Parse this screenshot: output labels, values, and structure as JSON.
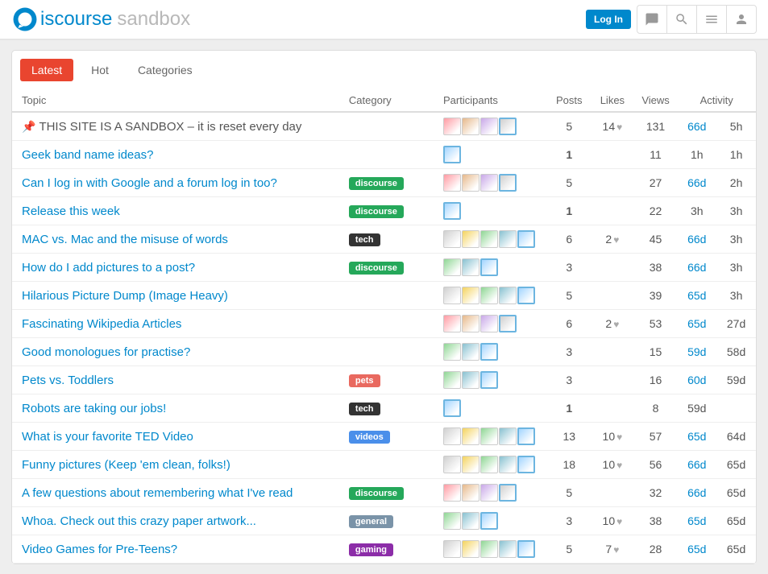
{
  "header": {
    "logo_main": "iscourse",
    "logo_sub": "sandbox",
    "login": "Log In"
  },
  "tabs": {
    "latest": "Latest",
    "hot": "Hot",
    "categories": "Categories"
  },
  "columns": {
    "topic": "Topic",
    "category": "Category",
    "participants": "Participants",
    "posts": "Posts",
    "likes": "Likes",
    "views": "Views",
    "activity": "Activity"
  },
  "topics": [
    {
      "title": "THIS SITE IS A SANDBOX – it is reset every day",
      "pinned": true,
      "dark": true,
      "category": "",
      "catclass": "",
      "avatars": 4,
      "posts": "5",
      "likes": "14",
      "views": "131",
      "act1": "66d",
      "act2": "5h"
    },
    {
      "title": "Geek band name ideas?",
      "pinned": false,
      "dark": false,
      "category": "",
      "catclass": "",
      "avatars": 1,
      "posts": "1",
      "likes": "",
      "views": "11",
      "act1": "1h",
      "act1link": false,
      "act2": "1h"
    },
    {
      "title": "Can I log in with Google and a forum log in too?",
      "pinned": false,
      "dark": false,
      "category": "discourse",
      "catclass": "cat-discourse",
      "avatars": 4,
      "posts": "5",
      "likes": "",
      "views": "27",
      "act1": "66d",
      "act2": "2h"
    },
    {
      "title": "Release this week",
      "pinned": false,
      "dark": false,
      "category": "discourse",
      "catclass": "cat-discourse",
      "avatars": 1,
      "posts": "1",
      "likes": "",
      "views": "22",
      "act1": "3h",
      "act1link": false,
      "act2": "3h"
    },
    {
      "title": "MAC vs. Mac and the misuse of words",
      "pinned": false,
      "dark": false,
      "category": "tech",
      "catclass": "cat-tech",
      "avatars": 5,
      "posts": "6",
      "likes": "2",
      "views": "45",
      "act1": "66d",
      "act2": "3h"
    },
    {
      "title": "How do I add pictures to a post?",
      "pinned": false,
      "dark": false,
      "category": "discourse",
      "catclass": "cat-discourse",
      "avatars": 3,
      "posts": "3",
      "likes": "",
      "views": "38",
      "act1": "66d",
      "act2": "3h"
    },
    {
      "title": "Hilarious Picture Dump (Image Heavy)",
      "pinned": false,
      "dark": false,
      "category": "",
      "catclass": "",
      "avatars": 5,
      "posts": "5",
      "likes": "",
      "views": "39",
      "act1": "65d",
      "act2": "3h"
    },
    {
      "title": "Fascinating Wikipedia Articles",
      "pinned": false,
      "dark": false,
      "category": "",
      "catclass": "",
      "avatars": 4,
      "posts": "6",
      "likes": "2",
      "views": "53",
      "act1": "65d",
      "act2": "27d"
    },
    {
      "title": "Good monologues for practise?",
      "pinned": false,
      "dark": false,
      "category": "",
      "catclass": "",
      "avatars": 3,
      "posts": "3",
      "likes": "",
      "views": "15",
      "act1": "59d",
      "act2": "58d"
    },
    {
      "title": "Pets vs. Toddlers",
      "pinned": false,
      "dark": false,
      "category": "pets",
      "catclass": "cat-pets",
      "avatars": 3,
      "posts": "3",
      "likes": "",
      "views": "16",
      "act1": "60d",
      "act2": "59d"
    },
    {
      "title": "Robots are taking our jobs!",
      "pinned": false,
      "dark": false,
      "category": "tech",
      "catclass": "cat-tech",
      "avatars": 1,
      "posts": "1",
      "likes": "",
      "views": "8",
      "act1": "59d",
      "act1link": false,
      "act2": ""
    },
    {
      "title": "What is your favorite TED Video",
      "pinned": false,
      "dark": false,
      "category": "videos",
      "catclass": "cat-videos",
      "avatars": 5,
      "posts": "13",
      "likes": "10",
      "views": "57",
      "act1": "65d",
      "act2": "64d"
    },
    {
      "title": "Funny pictures (Keep 'em clean, folks!)",
      "pinned": false,
      "dark": false,
      "category": "",
      "catclass": "",
      "avatars": 5,
      "posts": "18",
      "likes": "10",
      "views": "56",
      "act1": "66d",
      "act2": "65d"
    },
    {
      "title": "A few questions about remembering what I've read",
      "pinned": false,
      "dark": false,
      "category": "discourse",
      "catclass": "cat-discourse",
      "avatars": 4,
      "posts": "5",
      "likes": "",
      "views": "32",
      "act1": "66d",
      "act2": "65d"
    },
    {
      "title": "Whoa. Check out this crazy paper artwork...",
      "pinned": false,
      "dark": false,
      "category": "general",
      "catclass": "cat-general",
      "avatars": 3,
      "posts": "3",
      "likes": "10",
      "views": "38",
      "act1": "65d",
      "act2": "65d"
    },
    {
      "title": "Video Games for Pre-Teens?",
      "pinned": false,
      "dark": false,
      "category": "gaming",
      "catclass": "cat-gaming",
      "avatars": 5,
      "posts": "5",
      "likes": "7",
      "views": "28",
      "act1": "65d",
      "act2": "65d"
    }
  ]
}
